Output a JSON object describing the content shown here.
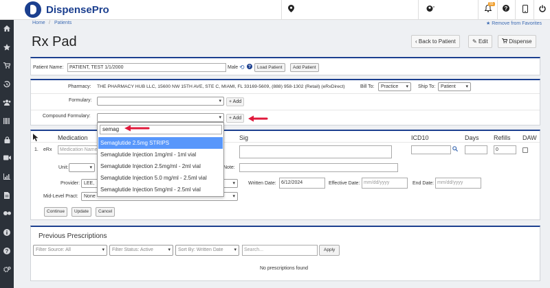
{
  "app": {
    "name": "DispensePro",
    "bell_badge": "55"
  },
  "breadcrumb": {
    "home": "Home",
    "sep": "/",
    "patients": "Patients"
  },
  "favorites": {
    "label": "Remove from Favorites"
  },
  "page": {
    "title": "Rx Pad"
  },
  "header_buttons": {
    "back": "Back to Patient",
    "edit": "Edit",
    "dispense": "Dispense"
  },
  "patient": {
    "label": "Patient Name:",
    "value": "PATIENT, TEST 1/1/2000",
    "gender": "Male",
    "load_btn": "Load Patient",
    "add_btn": "Add Patient"
  },
  "pharmacy": {
    "label": "Pharmacy:",
    "value": "THE PHARMACY HUB LLC, 15600 NW 15TH AVE, STE C, MIAMI, FL 33169-5609, (888) 958-1302 (Retail) (eRxDirect)",
    "bill_to_label": "Bill To:",
    "bill_to": "Practice",
    "ship_to_label": "Ship To:",
    "ship_to": "Patient"
  },
  "formulary": {
    "label": "Formulary:",
    "add": "Add"
  },
  "compound": {
    "label": "Compound Formulary:",
    "add": "Add"
  },
  "dropdown": {
    "search": "semag",
    "items": [
      "Semaglutide 2.5mg STRIPS",
      "Semaglutide Injection 1mg/ml - 1ml vial",
      "Semaglutide Injection 2.5mg/ml - 2ml vial",
      "Semaglutide Injection 5.0 mg/ml - 2.5ml vial",
      "Semaglutide Injection 5mg/ml - 2.5ml vial"
    ]
  },
  "rx_table": {
    "headers": {
      "medication": "Medication",
      "sig": "Sig",
      "icd10": "ICD10",
      "days": "Days",
      "refills": "Refills",
      "daw": "DAW"
    },
    "row_number": "1.",
    "row_type": "eRx",
    "medication_placeholder": "Medication Name",
    "refills": "0",
    "unit_label": "Unit:",
    "provider_label": "Provider:",
    "provider_value": "LEE,",
    "midlevel_label": "Mid-Level Pract:",
    "midlevel_value": "None",
    "note_label": "Note:",
    "written_date_label": "Written Date:",
    "written_date": "6/12/2024",
    "effective_date_label": "Effective Date:",
    "effective_date_placeholder": "mm/dd/yyyy",
    "end_date_label": "End Date:",
    "end_date_placeholder": "mm/dd/yyyy",
    "buttons": {
      "continue": "Continue",
      "update": "Update",
      "cancel": "Cancel"
    }
  },
  "previous": {
    "title": "Previous Prescriptions",
    "filter_source": "Filter Source: All",
    "filter_status": "Filter Status: Active",
    "sort_by": "Sort By: Written Date",
    "search_placeholder": "Search...",
    "apply": "Apply",
    "empty": "No prescriptions found"
  },
  "colors": {
    "brand": "#1b3f8f",
    "nav_bg": "#2b3139",
    "highlight": "#5897fb",
    "arrow": "#e0193b"
  },
  "icons": [
    "map-pin-icon",
    "user-icon",
    "bell-icon",
    "question-icon",
    "mobile-icon",
    "power-icon"
  ]
}
